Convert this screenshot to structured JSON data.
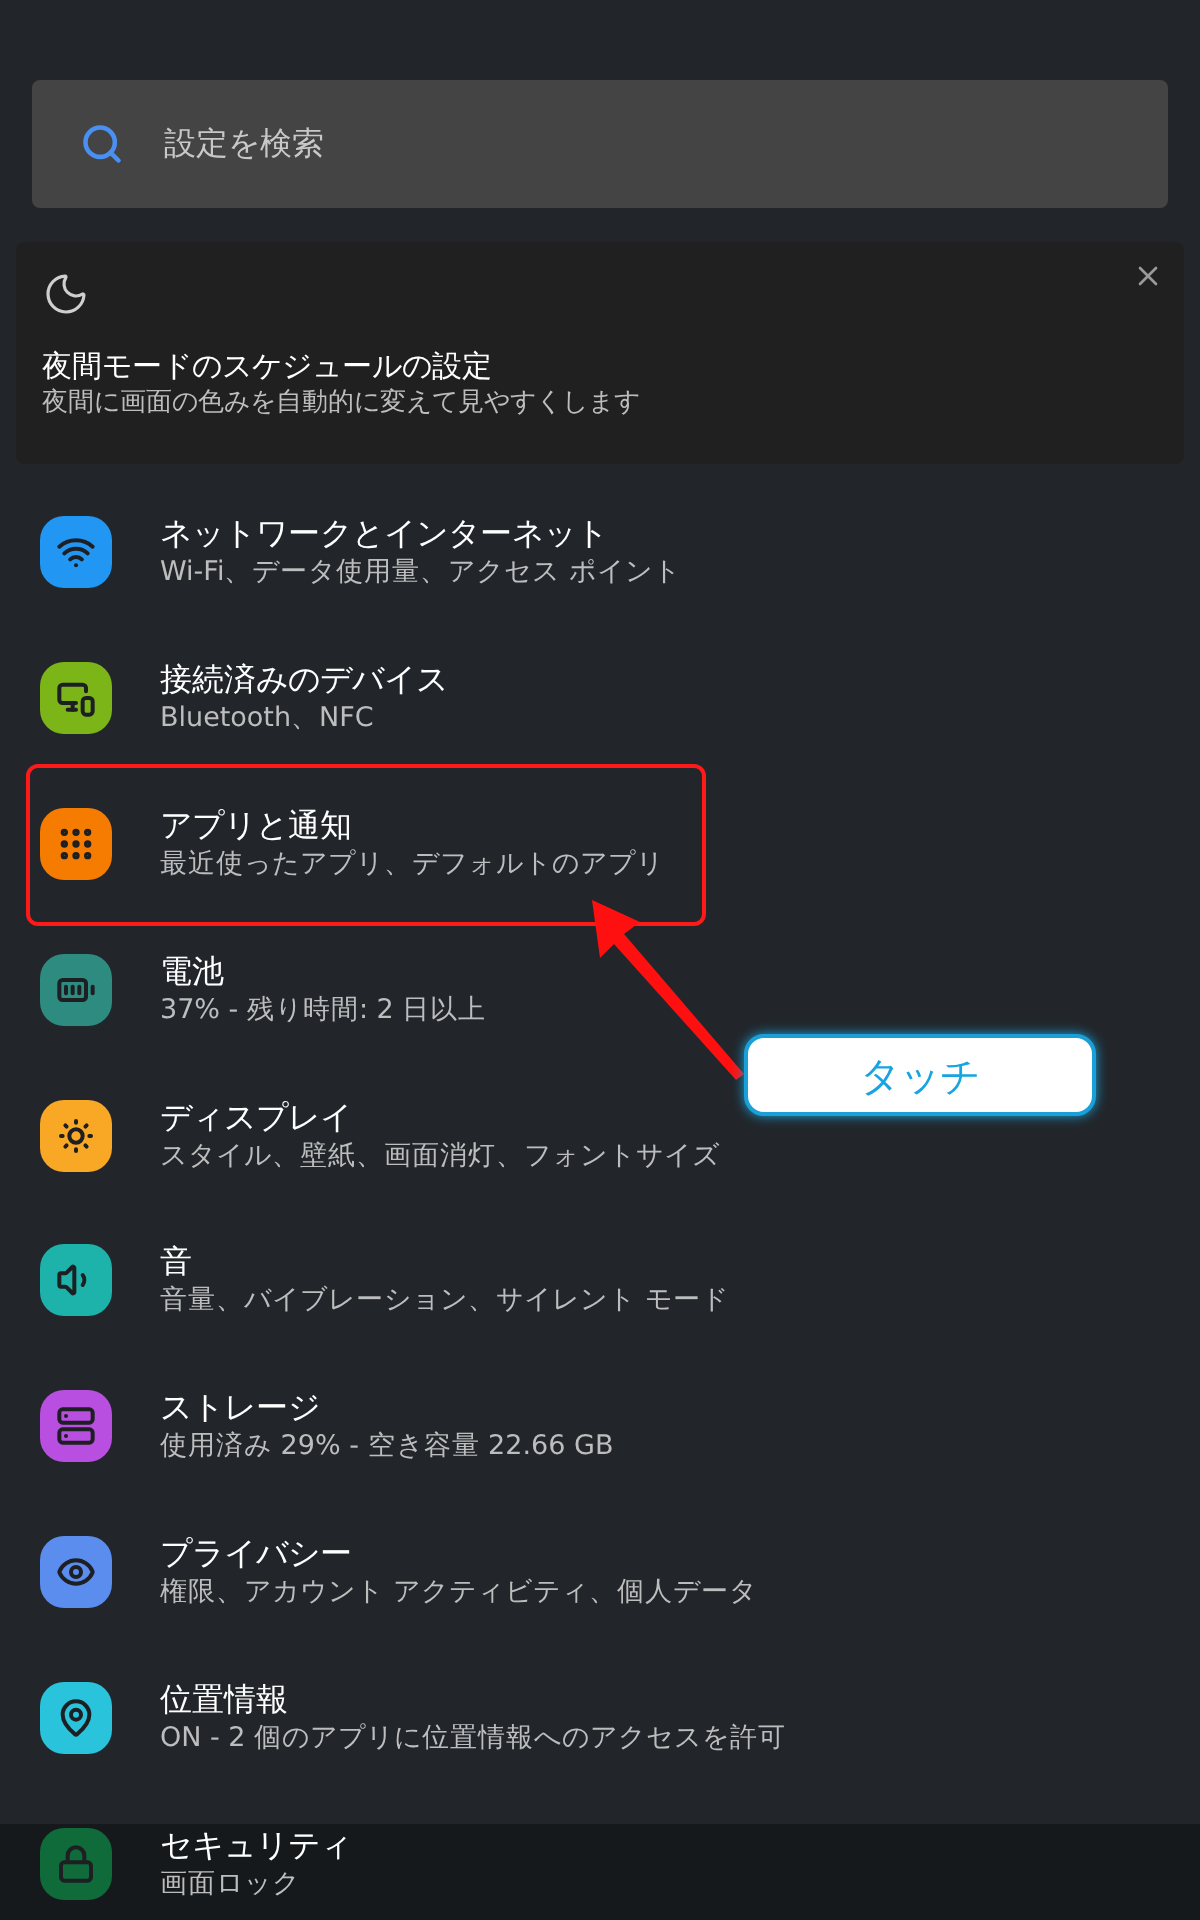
{
  "search": {
    "placeholder": "設定を検索"
  },
  "suggestion": {
    "title": "夜間モードのスケジュールの設定",
    "subtitle": "夜間に画面の色みを自動的に変えて見やすくします"
  },
  "items": [
    {
      "kind": "network",
      "color": "#2196f3",
      "title": "ネットワークとインターネット",
      "subtitle": "Wi-Fi、データ使用量、アクセス ポイント",
      "highlighted": false
    },
    {
      "kind": "devices",
      "color": "#7cb518",
      "title": "接続済みのデバイス",
      "subtitle": "Bluetooth、NFC",
      "highlighted": false
    },
    {
      "kind": "apps",
      "color": "#f57c00",
      "title": "アプリと通知",
      "subtitle": "最近使ったアプリ、デフォルトのアプリ",
      "highlighted": true
    },
    {
      "kind": "battery",
      "color": "#2e8b80",
      "title": "電池",
      "subtitle": "37% - 残り時間: 2 日以上",
      "highlighted": false
    },
    {
      "kind": "display",
      "color": "#f9a825",
      "title": "ディスプレイ",
      "subtitle": "スタイル、壁紙、画面消灯、フォントサイズ",
      "highlighted": false
    },
    {
      "kind": "sound",
      "color": "#1db3aa",
      "title": "音",
      "subtitle": "音量、バイブレーション、サイレント モード",
      "highlighted": false
    },
    {
      "kind": "storage",
      "color": "#b84fe0",
      "title": "ストレージ",
      "subtitle": "使用済み 29% - 空き容量 22.66 GB",
      "highlighted": false
    },
    {
      "kind": "privacy",
      "color": "#5b8def",
      "title": "プライバシー",
      "subtitle": "権限、アカウント アクティビティ、個人データ",
      "highlighted": false
    },
    {
      "kind": "location",
      "color": "#29c3dc",
      "title": "位置情報",
      "subtitle": "ON - 2 個のアプリに位置情報へのアクセスを許可",
      "highlighted": false
    },
    {
      "kind": "security",
      "color": "#0f6b3a",
      "title": "セキュリティ",
      "subtitle": "画面ロック",
      "highlighted": false
    }
  ],
  "callout": {
    "text": "タッチ"
  }
}
